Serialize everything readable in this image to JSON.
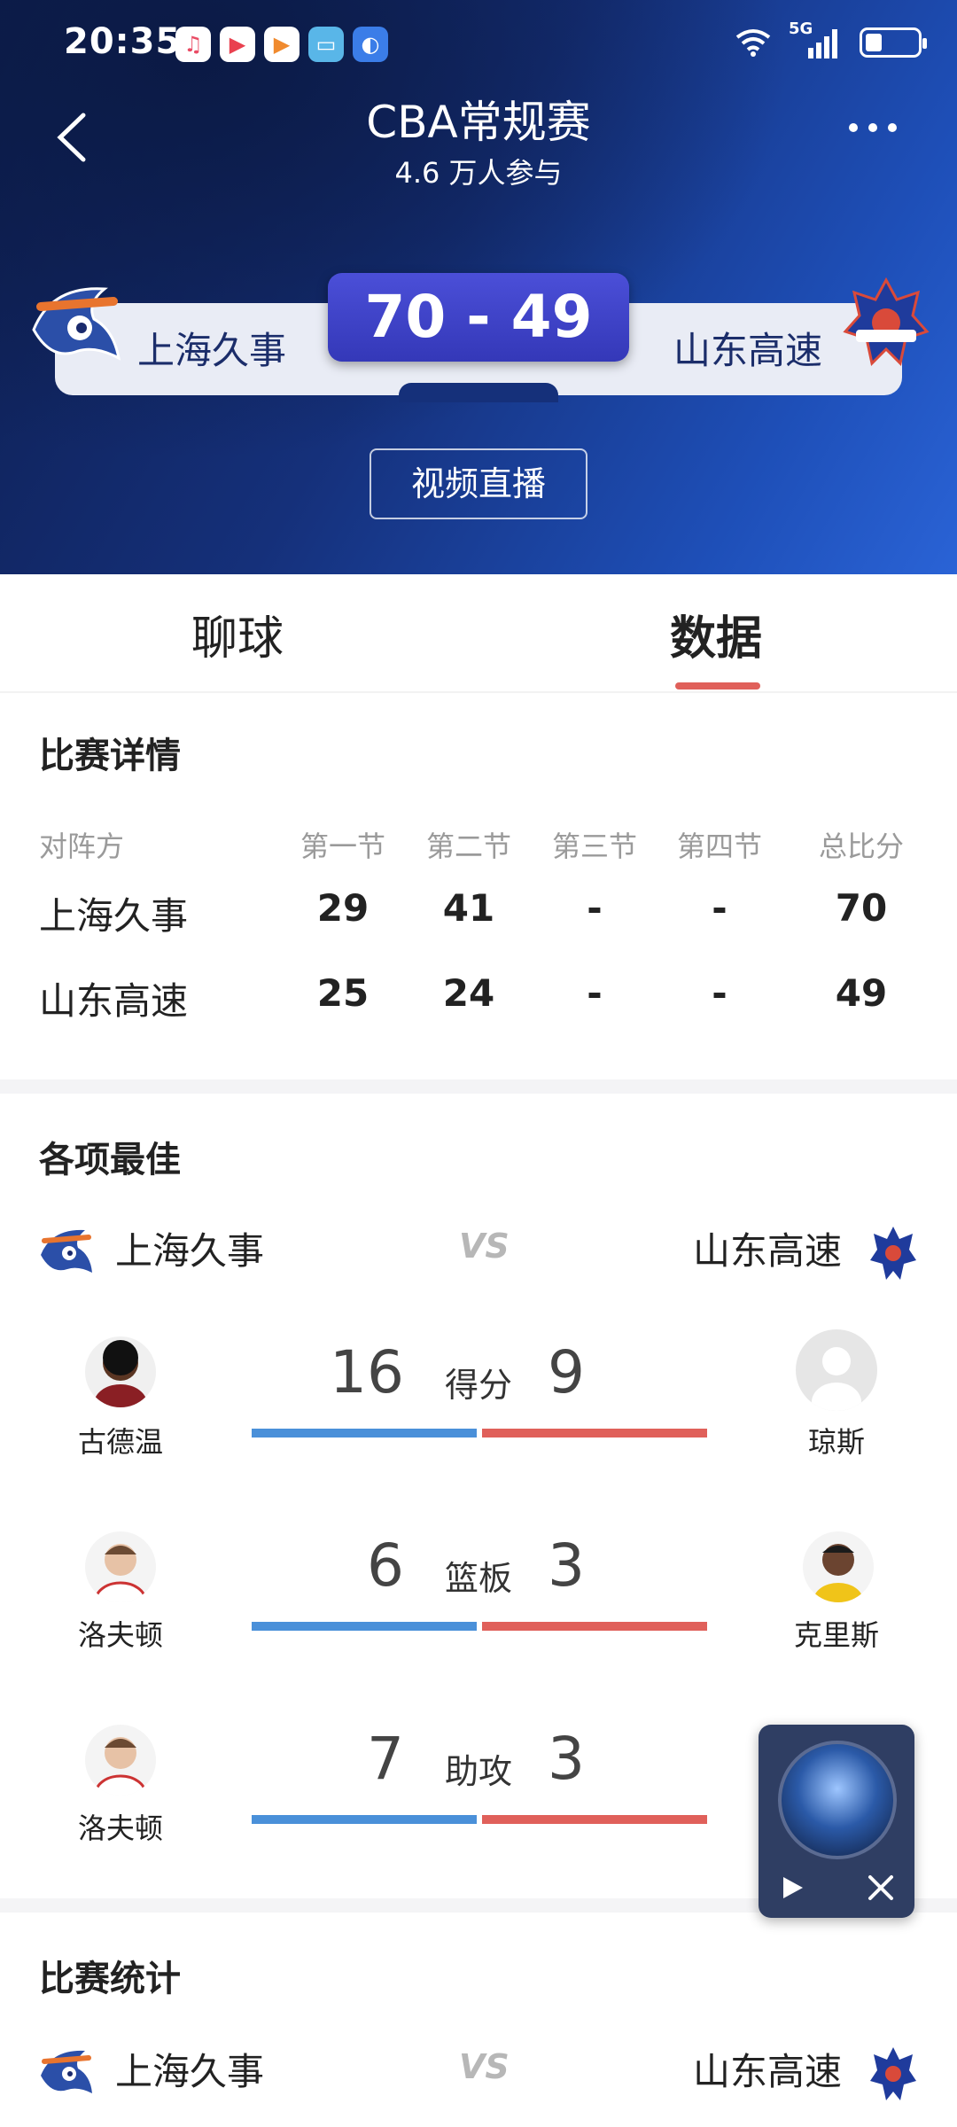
{
  "status": {
    "time": "20:35",
    "network": "5G"
  },
  "header": {
    "title": "CBA常规赛",
    "subtitle": "4.6 万人参与",
    "score": "70 - 49",
    "home_team": "上海久事",
    "away_team": "山东高速",
    "live_button": "视频直播"
  },
  "tabs": [
    {
      "label": "聊球"
    },
    {
      "label": "数据"
    }
  ],
  "match_detail": {
    "title": "比赛详情",
    "columns": [
      "对阵方",
      "第一节",
      "第二节",
      "第三节",
      "第四节",
      "总比分"
    ],
    "rows": [
      {
        "team": "上海久事",
        "q1": "29",
        "q2": "41",
        "q3": "-",
        "q4": "-",
        "total": "70"
      },
      {
        "team": "山东高速",
        "q1": "25",
        "q2": "24",
        "q3": "-",
        "q4": "-",
        "total": "49"
      }
    ]
  },
  "best": {
    "title": "各项最佳",
    "home_team": "上海久事",
    "away_team": "山东高速",
    "vs": "VS",
    "stats": [
      {
        "label": "得分",
        "home_player": "古德温",
        "home_value": "16",
        "away_player": "琼斯",
        "away_value": "9"
      },
      {
        "label": "篮板",
        "home_player": "洛夫顿",
        "home_value": "6",
        "away_player": "克里斯",
        "away_value": "3"
      },
      {
        "label": "助攻",
        "home_player": "洛夫顿",
        "home_value": "7",
        "away_player": "",
        "away_value": "3"
      }
    ]
  },
  "match_stats": {
    "title": "比赛统计",
    "home_team": "上海久事",
    "away_team": "山东高速",
    "vs": "VS"
  },
  "colors": {
    "accent_red": "#e0605a",
    "bar_blue": "#4a90d9",
    "score_box": "#3a3fc4"
  },
  "icons": [
    "back-icon",
    "more-icon",
    "sharks-logo",
    "shandong-logo",
    "play-icon",
    "close-icon"
  ]
}
